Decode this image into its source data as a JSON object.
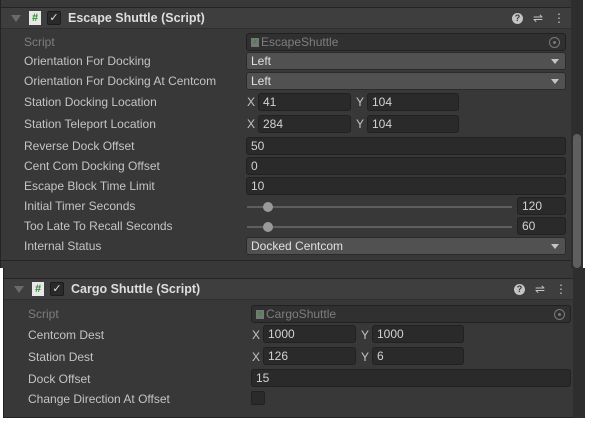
{
  "escape": {
    "title": "Escape Shuttle (Script)",
    "check": "✓",
    "hash": "#",
    "script_label": "Script",
    "script_value": "EscapeShuttle",
    "orientation_label": "Orientation For Docking",
    "orientation_value": "Left",
    "orientation_centcom_label": "Orientation For Docking At Centcom",
    "orientation_centcom_value": "Left",
    "docking_label": "Station Docking Location",
    "docking_x": "41",
    "docking_y": "104",
    "teleport_label": "Station Teleport Location",
    "teleport_x": "284",
    "teleport_y": "104",
    "reverse_label": "Reverse Dock Offset",
    "reverse_value": "50",
    "centcom_offset_label": "Cent Com Docking Offset",
    "centcom_offset_value": "0",
    "escape_block_label": "Escape Block Time Limit",
    "escape_block_value": "10",
    "timer_label": "Initial Timer Seconds",
    "timer_value": "120",
    "recall_label": "Too Late To Recall Seconds",
    "recall_value": "60",
    "status_label": "Internal Status",
    "status_value": "Docked Centcom"
  },
  "cargo": {
    "title": "Cargo Shuttle (Script)",
    "check": "✓",
    "hash": "#",
    "script_label": "Script",
    "script_value": "CargoShuttle",
    "centcom_label": "Centcom Dest",
    "centcom_x": "1000",
    "centcom_y": "1000",
    "station_label": "Station Dest",
    "station_x": "126",
    "station_y": "6",
    "dock_label": "Dock Offset",
    "dock_value": "15",
    "change_label": "Change Direction At Offset",
    "change_checked": false
  },
  "axis": {
    "x": "X",
    "y": "Y"
  },
  "icons": {
    "help": "?",
    "presets": "⇌",
    "menu": "⋮"
  }
}
